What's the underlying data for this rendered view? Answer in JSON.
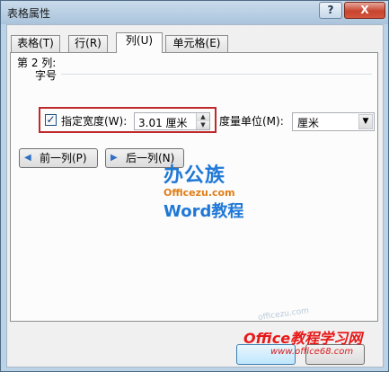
{
  "window": {
    "title": "表格属性"
  },
  "titlebar": {
    "help_glyph": "?",
    "close_glyph": "X"
  },
  "tabs": [
    {
      "label": "表格(T)",
      "active": false
    },
    {
      "label": "行(R)",
      "active": false
    },
    {
      "label": "列(U)",
      "active": true
    },
    {
      "label": "单元格(E)",
      "active": false
    }
  ],
  "column_panel": {
    "size_label": "第 2 列:",
    "size_sub": "字号",
    "specify_width_label": "指定宽度(W):",
    "specify_width_checked": true,
    "width_value": "3.01 厘米",
    "unit_label": "度量单位(M):",
    "unit_value": "厘米",
    "prev_button": "前一列(P)",
    "next_button": "后一列(N)"
  },
  "overlay": {
    "logo_line1": "办公族",
    "logo_line2": "Officezu.com",
    "logo_line3": "Word教程",
    "watermark_text": "Office教程学习网",
    "watermark_url": "www.office68.com",
    "watermark_faint": "officezu.com"
  },
  "colors": {
    "highlight_box": "#c0292b",
    "watermark": "#e81818",
    "logo_blue": "#1f78d6",
    "logo_orange": "#e07d16"
  }
}
